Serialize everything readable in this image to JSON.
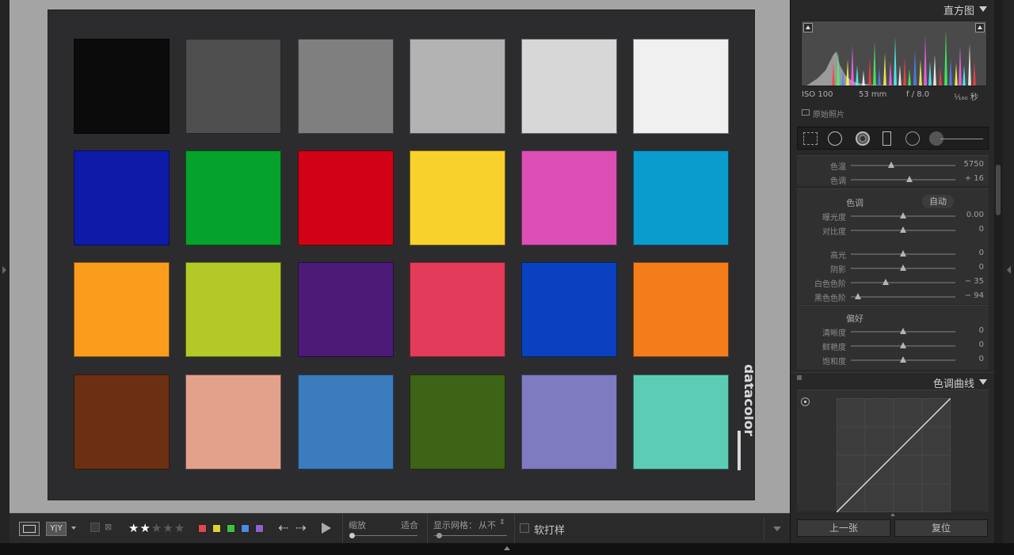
{
  "panels": {
    "histogram": {
      "title": "直方图",
      "exif": {
        "iso": "ISO 100",
        "focal": "53 mm",
        "aperture": "f / 8.0",
        "shutter": "¹⁄₁₆₀ 秒"
      },
      "original_photo_label": "原始照片"
    },
    "basic": {
      "white_balance": [
        {
          "label": "色温",
          "value": "5750",
          "pos": 0.39
        },
        {
          "label": "色调",
          "value": "+ 16",
          "pos": 0.56
        }
      ],
      "tone": {
        "title": "色调",
        "auto_label": "自动",
        "sliders_a": [
          {
            "label": "曝光度",
            "value": "0.00",
            "pos": 0.5
          },
          {
            "label": "对比度",
            "value": "0",
            "pos": 0.5
          }
        ],
        "sliders_b": [
          {
            "label": "高光",
            "value": "0",
            "pos": 0.5
          },
          {
            "label": "阴影",
            "value": "0",
            "pos": 0.5
          },
          {
            "label": "白色色阶",
            "value": "− 35",
            "pos": 0.33
          },
          {
            "label": "黑色色阶",
            "value": "− 94",
            "pos": 0.07
          }
        ]
      },
      "presence": {
        "title": "偏好",
        "sliders": [
          {
            "label": "清晰度",
            "value": "0",
            "pos": 0.5
          },
          {
            "label": "鲜艳度",
            "value": "0",
            "pos": 0.5
          },
          {
            "label": "饱和度",
            "value": "0",
            "pos": 0.5
          }
        ]
      }
    },
    "tone_curve": {
      "title": "色调曲线"
    }
  },
  "buttons": {
    "previous": "上一张",
    "reset": "复位"
  },
  "toolbar": {
    "rating": 2,
    "rating_max": 5,
    "zoom_label": "缩放",
    "zoom_fit": "适合",
    "grid_label": "显示网格：",
    "grid_value": "从不",
    "soft_proof_label": "软打样"
  },
  "colors": {
    "swatches": [
      "#0b0b0c",
      "#4e4e4f",
      "#7f7f80",
      "#b3b3b4",
      "#d7d7d8",
      "#f0f0f1",
      "#0d1ba8",
      "#05a32c",
      "#d10217",
      "#f9d12c",
      "#db4fb4",
      "#0a9ccc",
      "#fa9d1d",
      "#b3c927",
      "#4c1a77",
      "#e33b5a",
      "#0b41c0",
      "#f57c1a",
      "#6b3014",
      "#e3a18c",
      "#3a7cbd",
      "#3c6316",
      "#7f7bc0",
      "#5ccdb4"
    ],
    "labels": [
      "#e04848",
      "#e0d030",
      "#40c040",
      "#4a8ae0",
      "#9060d0"
    ]
  }
}
